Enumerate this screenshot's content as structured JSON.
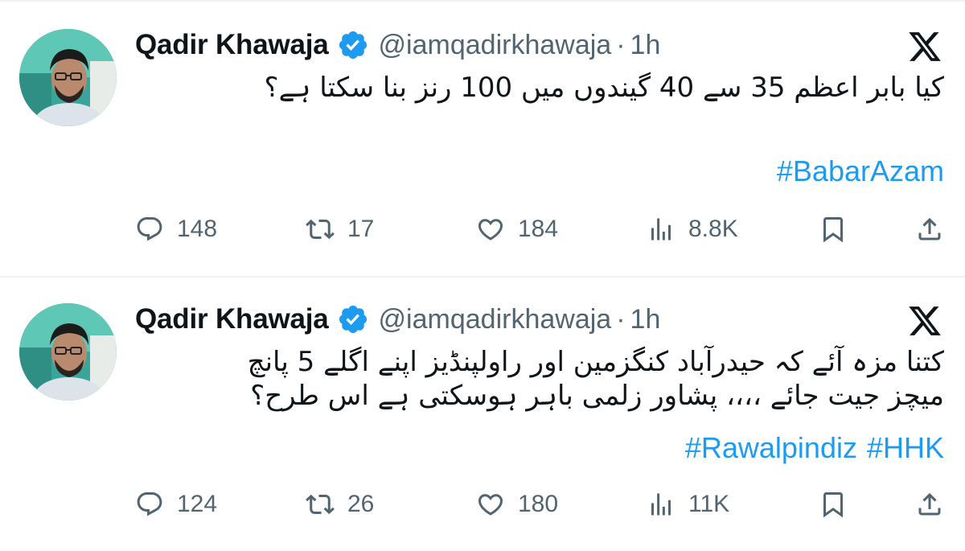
{
  "colors": {
    "accent": "#1d9bf0",
    "muted": "#536471",
    "text": "#0f1419",
    "divider": "#eff3f4"
  },
  "tweets": [
    {
      "author": {
        "name": "Qadir Khawaja",
        "handle": "@iamqadirkhawaja",
        "time": "1h",
        "separator": "·"
      },
      "text_lines": [
        "کیا بابر اعظم 35 سے 40 گیندوں میں 100 رنز بنا سکتا ہے؟"
      ],
      "hashtags": [
        "#BabarAzam"
      ],
      "stats": {
        "replies": "148",
        "reposts": "17",
        "likes": "184",
        "views": "8.8K"
      }
    },
    {
      "author": {
        "name": "Qadir Khawaja",
        "handle": "@iamqadirkhawaja",
        "time": "1h",
        "separator": "·"
      },
      "text_lines": [
        "کتنا مزہ آئے کہ حیدرآباد کنگزمین اور راولپنڈیز اپنے اگلے 5 پانچ",
        "میچز جیت جائے ،،،، پشاور زلمی باہر ہوسکتی ہے اس طرح؟"
      ],
      "hashtags": [
        "#Rawalpindiz",
        "#HHK"
      ],
      "stats": {
        "replies": "124",
        "reposts": "26",
        "likes": "180",
        "views": "11K"
      }
    }
  ],
  "icons": {
    "verified": "verified-badge-icon",
    "platform": "x-logo-icon",
    "reply": "reply-icon",
    "repost": "repost-icon",
    "like": "heart-icon",
    "views": "views-chart-icon",
    "bookmark": "bookmark-icon",
    "share": "share-icon"
  }
}
